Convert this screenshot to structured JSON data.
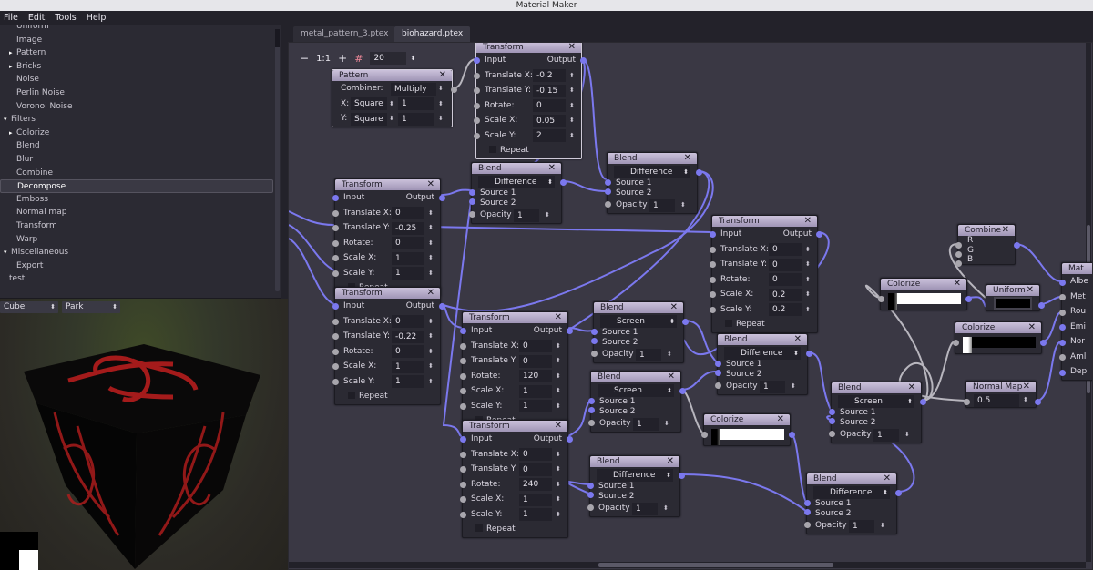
{
  "window": {
    "title": "Material Maker"
  },
  "menu": [
    "File",
    "Edit",
    "Tools",
    "Help"
  ],
  "library": {
    "items": [
      {
        "label": "Uniform",
        "indent": 2,
        "arrow": ""
      },
      {
        "label": "Image",
        "indent": 2,
        "arrow": ""
      },
      {
        "label": "Pattern",
        "indent": 1,
        "arrow": "▸"
      },
      {
        "label": "Bricks",
        "indent": 1,
        "arrow": "▸"
      },
      {
        "label": "Noise",
        "indent": 2,
        "arrow": ""
      },
      {
        "label": "Perlin Noise",
        "indent": 2,
        "arrow": ""
      },
      {
        "label": "Voronoi Noise",
        "indent": 2,
        "arrow": ""
      },
      {
        "label": "Filters",
        "indent": 0,
        "arrow": "▾"
      },
      {
        "label": "Colorize",
        "indent": 1,
        "arrow": "▸"
      },
      {
        "label": "Blend",
        "indent": 2,
        "arrow": ""
      },
      {
        "label": "Blur",
        "indent": 2,
        "arrow": ""
      },
      {
        "label": "Combine",
        "indent": 2,
        "arrow": ""
      },
      {
        "label": "Decompose",
        "indent": 2,
        "arrow": "",
        "selected": true
      },
      {
        "label": "Emboss",
        "indent": 2,
        "arrow": ""
      },
      {
        "label": "Normal map",
        "indent": 2,
        "arrow": ""
      },
      {
        "label": "Transform",
        "indent": 2,
        "arrow": ""
      },
      {
        "label": "Warp",
        "indent": 2,
        "arrow": ""
      },
      {
        "label": "Miscellaneous",
        "indent": 0,
        "arrow": "▾"
      },
      {
        "label": "Export",
        "indent": 2,
        "arrow": ""
      },
      {
        "label": "test",
        "indent": 1,
        "arrow": ""
      }
    ]
  },
  "preview": {
    "model": "Cube",
    "environment": "Park"
  },
  "tabs": [
    {
      "label": "metal_pattern_3.ptex",
      "active": false
    },
    {
      "label": "biohazard.ptex",
      "active": true
    }
  ],
  "toolbar": {
    "zoom_out": "−",
    "reset_zoom": "1:1",
    "zoom_in": "+",
    "snap_icon": "#",
    "grid_size": "20"
  },
  "labels": {
    "input": "Input",
    "output": "Output",
    "translate_x": "Translate X:",
    "translate_y": "Translate Y:",
    "rotate": "Rotate:",
    "scale_x": "Scale X:",
    "scale_y": "Scale Y:",
    "repeat": "Repeat",
    "source1": "Source 1",
    "source2": "Source 2",
    "opacity": "Opacity",
    "combiner": "Combiner:",
    "x": "X:",
    "y": "Y:",
    "r": "R",
    "g": "G",
    "b": "B",
    "close": "✕"
  },
  "nodes": {
    "pattern": {
      "title": "Pattern",
      "combiner": "Multiply",
      "x_shape": "Square",
      "x_value": "1",
      "y_shape": "Square",
      "y_value": "1"
    },
    "transform_top": {
      "title": "Transform",
      "tx": "-0.2",
      "ty": "-0.15",
      "rot": "0",
      "sx": "0.05",
      "sy": "2"
    },
    "transform_a": {
      "title": "Transform",
      "tx": "0",
      "ty": "-0.25",
      "rot": "0",
      "sx": "1",
      "sy": "1"
    },
    "transform_b": {
      "title": "Transform",
      "tx": "0",
      "ty": "-0.22",
      "rot": "0",
      "sx": "1",
      "sy": "1"
    },
    "transform_c": {
      "title": "Transform",
      "tx": "0",
      "ty": "0",
      "rot": "120",
      "sx": "1",
      "sy": "1"
    },
    "transform_d": {
      "title": "Transform",
      "tx": "0",
      "ty": "0",
      "rot": "240",
      "sx": "1",
      "sy": "1"
    },
    "transform_e": {
      "title": "Transform",
      "tx": "0",
      "ty": "0",
      "rot": "0",
      "sx": "0.2",
      "sy": "0.2"
    },
    "blend1": {
      "title": "Blend",
      "mode": "Difference",
      "opacity": "1"
    },
    "blend2": {
      "title": "Blend",
      "mode": "Difference",
      "opacity": "1"
    },
    "blend3": {
      "title": "Blend",
      "mode": "Screen",
      "opacity": "1"
    },
    "blend4": {
      "title": "Blend",
      "mode": "Screen",
      "opacity": "1"
    },
    "blend5": {
      "title": "Blend",
      "mode": "Difference",
      "opacity": "1"
    },
    "blend6": {
      "title": "Blend",
      "mode": "Difference",
      "opacity": "1"
    },
    "blend7": {
      "title": "Blend",
      "mode": "Screen",
      "opacity": "1"
    },
    "blend8": {
      "title": "Blend",
      "mode": "Difference",
      "opacity": "1"
    },
    "colorize1": {
      "title": "Colorize"
    },
    "colorize2": {
      "title": "Colorize"
    },
    "colorize3": {
      "title": "Colorize"
    },
    "combine": {
      "title": "Combine"
    },
    "uniform": {
      "title": "Uniform",
      "color": "#000000"
    },
    "normal_map": {
      "title": "Normal Map",
      "amount": "0.5"
    },
    "material": {
      "title": "Mat",
      "inputs": [
        "Albe",
        "Met",
        "Rou",
        "Emi",
        "Nor",
        "Aml",
        "Dep"
      ]
    }
  },
  "colors": {
    "wire": "#7b78ee",
    "wire_gray": "#b8b6be",
    "header": "#b9aecb",
    "canvas": "#3a3844"
  }
}
